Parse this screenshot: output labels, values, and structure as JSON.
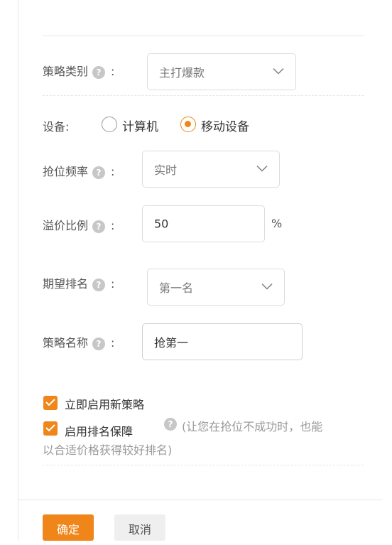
{
  "form": {
    "strategy_type": {
      "label": "策略类别",
      "colon": ":",
      "help": "?",
      "value": "主打爆款"
    },
    "device": {
      "label": "设备:",
      "options": [
        {
          "label": "计算机",
          "selected": false
        },
        {
          "label": "移动设备",
          "selected": true
        }
      ]
    },
    "frequency": {
      "label": "抢位频率",
      "colon": ":",
      "help": "?",
      "value": "实时"
    },
    "premium": {
      "label": "溢价比例",
      "colon": ":",
      "help": "?",
      "value": "50",
      "unit": "%"
    },
    "rank": {
      "label": "期望排名",
      "colon": ":",
      "help": "?",
      "value": "第一名"
    },
    "name": {
      "label": "策略名称",
      "colon": ":",
      "help": "?",
      "value": "抢第一"
    },
    "enable_now": {
      "label": "立即启用新策略",
      "checked": true
    },
    "rank_guarantee": {
      "label": "启用排名保障",
      "checked": true,
      "help": "?",
      "note_line1": "(让您在抢位不成功时，也能",
      "note_line2": "以合适价格获得较好排名)"
    }
  },
  "actions": {
    "confirm": "确定",
    "cancel": "取消"
  },
  "colors": {
    "accent": "#f08519",
    "border": "#dcdcdc",
    "muted": "#999999"
  }
}
